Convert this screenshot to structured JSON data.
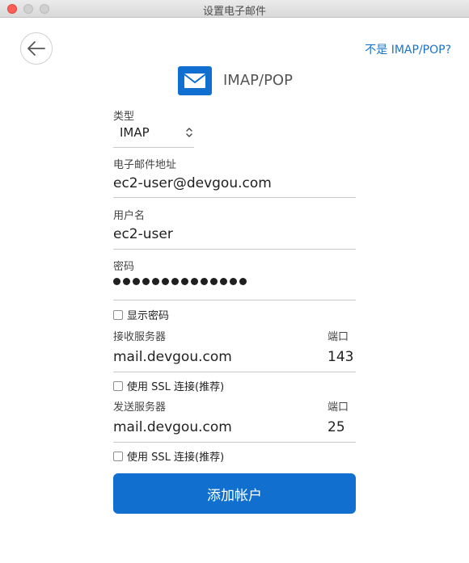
{
  "window": {
    "title": "设置电子邮件"
  },
  "header": {
    "alt_link": "不是 IMAP/POP?",
    "account_type_label": "IMAP/POP"
  },
  "form": {
    "type_label": "类型",
    "type_value": "IMAP",
    "email_label": "电子邮件地址",
    "email_value": "ec2-user@devgou.com",
    "username_label": "用户名",
    "username_value": "ec2-user",
    "password_label": "密码",
    "password_length": 14,
    "show_password_label": "显示密码",
    "incoming_label": "接收服务器",
    "incoming_port_label": "端口",
    "incoming_server_value": "mail.devgou.com",
    "incoming_port_value": "143",
    "incoming_ssl_label": "使用 SSL 连接(推荐)",
    "outgoing_label": "发送服务器",
    "outgoing_port_label": "端口",
    "outgoing_server_value": "mail.devgou.com",
    "outgoing_port_value": "25",
    "outgoing_ssl_label": "使用 SSL 连接(推荐)",
    "submit_label": "添加帐户"
  },
  "colors": {
    "accent": "#1170cf",
    "link": "#1a73c9"
  },
  "icons": {
    "back": "arrow-left-icon",
    "mail": "envelope-icon",
    "select": "chevron-updown-icon"
  }
}
